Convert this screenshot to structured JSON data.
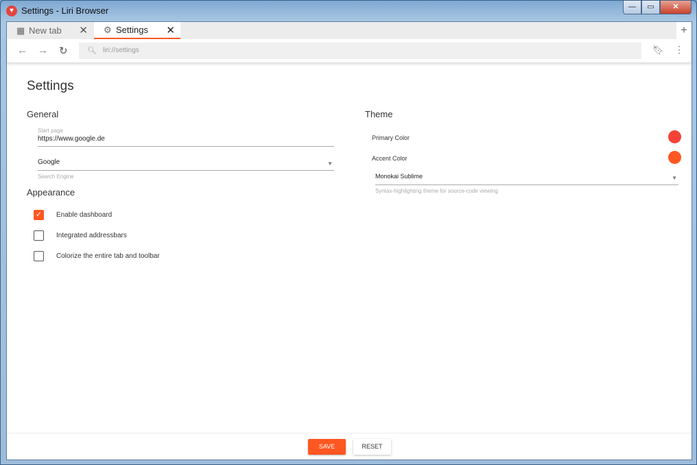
{
  "window": {
    "title": "Settings - Liri Browser",
    "minimize": "—",
    "maximize": "▭",
    "close": "✕"
  },
  "tabs": [
    {
      "label": "New tab",
      "icon": "dashboard-icon"
    },
    {
      "label": "Settings",
      "icon": "gear-icon"
    }
  ],
  "toolbar": {
    "url": "liri://settings",
    "back": "←",
    "forward": "→",
    "reload": "↻"
  },
  "settings": {
    "title": "Settings",
    "general": {
      "heading": "General",
      "start_page_label": "Start page",
      "start_page_value": "https://www.google.de",
      "search_engine_value": "Google",
      "search_engine_label": "Search Engine"
    },
    "appearance": {
      "heading": "Appearance",
      "options": [
        {
          "label": "Enable dashboard",
          "checked": true
        },
        {
          "label": "Integrated addressbars",
          "checked": false
        },
        {
          "label": "Colorize the entire tab and toolbar",
          "checked": false
        }
      ]
    },
    "theme": {
      "heading": "Theme",
      "primary_label": "Primary Color",
      "primary_color": "#f44336",
      "accent_label": "Accent Color",
      "accent_color": "#ff5722",
      "syntax_value": "Monokai Sublime",
      "syntax_label": "Syntax-highlighting theme for source-code viewing"
    }
  },
  "footer": {
    "save": "SAVE",
    "reset": "RESET"
  }
}
